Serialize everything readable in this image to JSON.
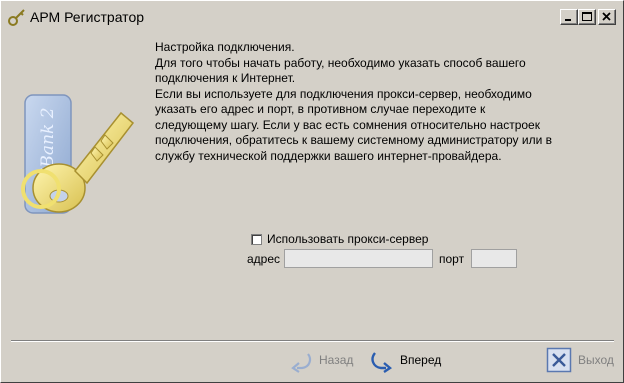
{
  "window": {
    "title": "АРМ Регистратор"
  },
  "intro": {
    "heading": "Настройка подключения.",
    "line1": "Для того чтобы начать работу, необходимо указать способ вашего",
    "line2": "подключения к Интернет.",
    "line3": "Если вы используете для подключения прокси-сервер, необходимо",
    "line4": "указать его адрес и порт, в противном случае переходите к",
    "line5": "следующему шагу. Если у вас есть сомнения относительно настроек",
    "line6": "подключения, обратитесь к вашему системному администратору или в",
    "line7": "службу технической поддержки вашего интернет-провайдера."
  },
  "proxy": {
    "checkbox_label": "Использовать прокси-сервер",
    "checked": false,
    "address_label": "адрес",
    "address_value": "",
    "port_label": "порт",
    "port_value": ""
  },
  "illustration": {
    "card_text": "iBank 2"
  },
  "nav": {
    "back_label": "Назад",
    "next_label": "Вперед",
    "exit_label": "Выход"
  },
  "colors": {
    "background": "#d4d0c8",
    "accent_blue": "#2a5db0",
    "disabled_text": "#808080"
  }
}
